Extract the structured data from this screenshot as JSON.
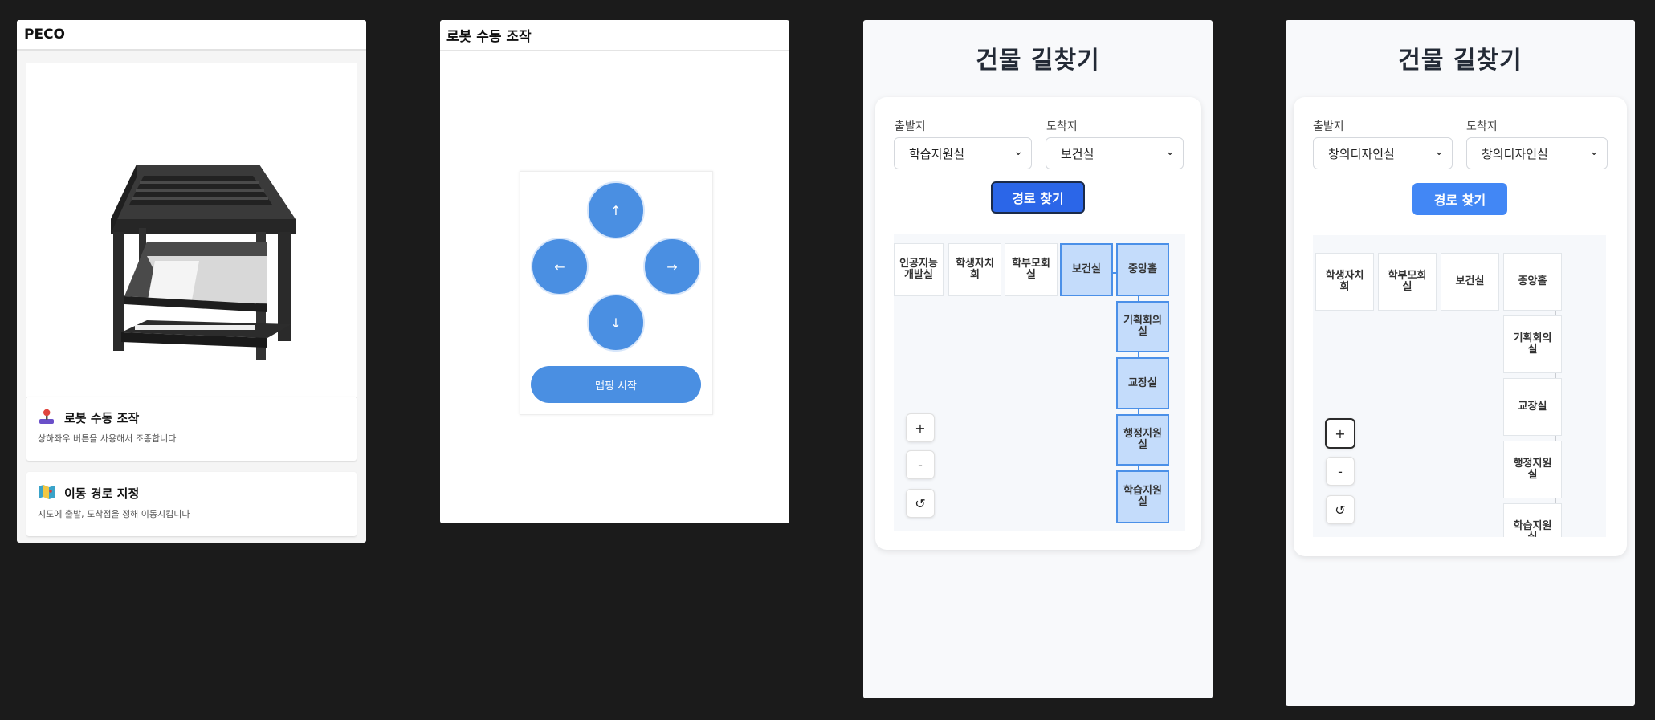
{
  "home": {
    "title": "PECO",
    "cards": [
      {
        "icon": "joystick-icon",
        "title": "로봇 수동 조작",
        "desc": "상하좌우 버튼을 사용해서 조종합니다"
      },
      {
        "icon": "map-icon",
        "title": "이동 경로 지정",
        "desc": "지도에 출발, 도착점을 정해 이동시킵니다"
      }
    ]
  },
  "control": {
    "title": "로봇 수동 조작",
    "up": "↑",
    "left": "←",
    "right": "→",
    "down": "↓",
    "mapping_button": "맵핑 시작"
  },
  "nav1": {
    "title": "건물 길찾기",
    "origin_label": "출발지",
    "origin_value": "학습지원실",
    "dest_label": "도착지",
    "dest_value": "보건실",
    "find_button": "경로 찾기",
    "rooms": [
      "인공지능\n개발실",
      "학생자치\n회",
      "학부모회\n실",
      "보건실",
      "중앙홀",
      "기획회의\n실",
      "교장실",
      "행정지원\n실",
      "학습지원\n실"
    ],
    "zoom_in": "+",
    "zoom_out": "-",
    "reset": "↺"
  },
  "nav2": {
    "title": "건물 길찾기",
    "origin_label": "출발지",
    "origin_value": "창의디자인실",
    "dest_label": "도착지",
    "dest_value": "창의디자인실",
    "find_button": "경로 찾기",
    "rooms": [
      "학생자치\n회",
      "학부모회\n실",
      "보건실",
      "중앙홀",
      "기획회의\n실",
      "교장실",
      "행정지원\n실",
      "학습지원\n실"
    ],
    "zoom_in": "+",
    "zoom_out": "-",
    "reset": "↺"
  },
  "colors": {
    "accent": "#4a8fe2",
    "button_blue": "#4287f5",
    "route_highlight": "#c4dcfb",
    "background": "#1b1b1b"
  }
}
